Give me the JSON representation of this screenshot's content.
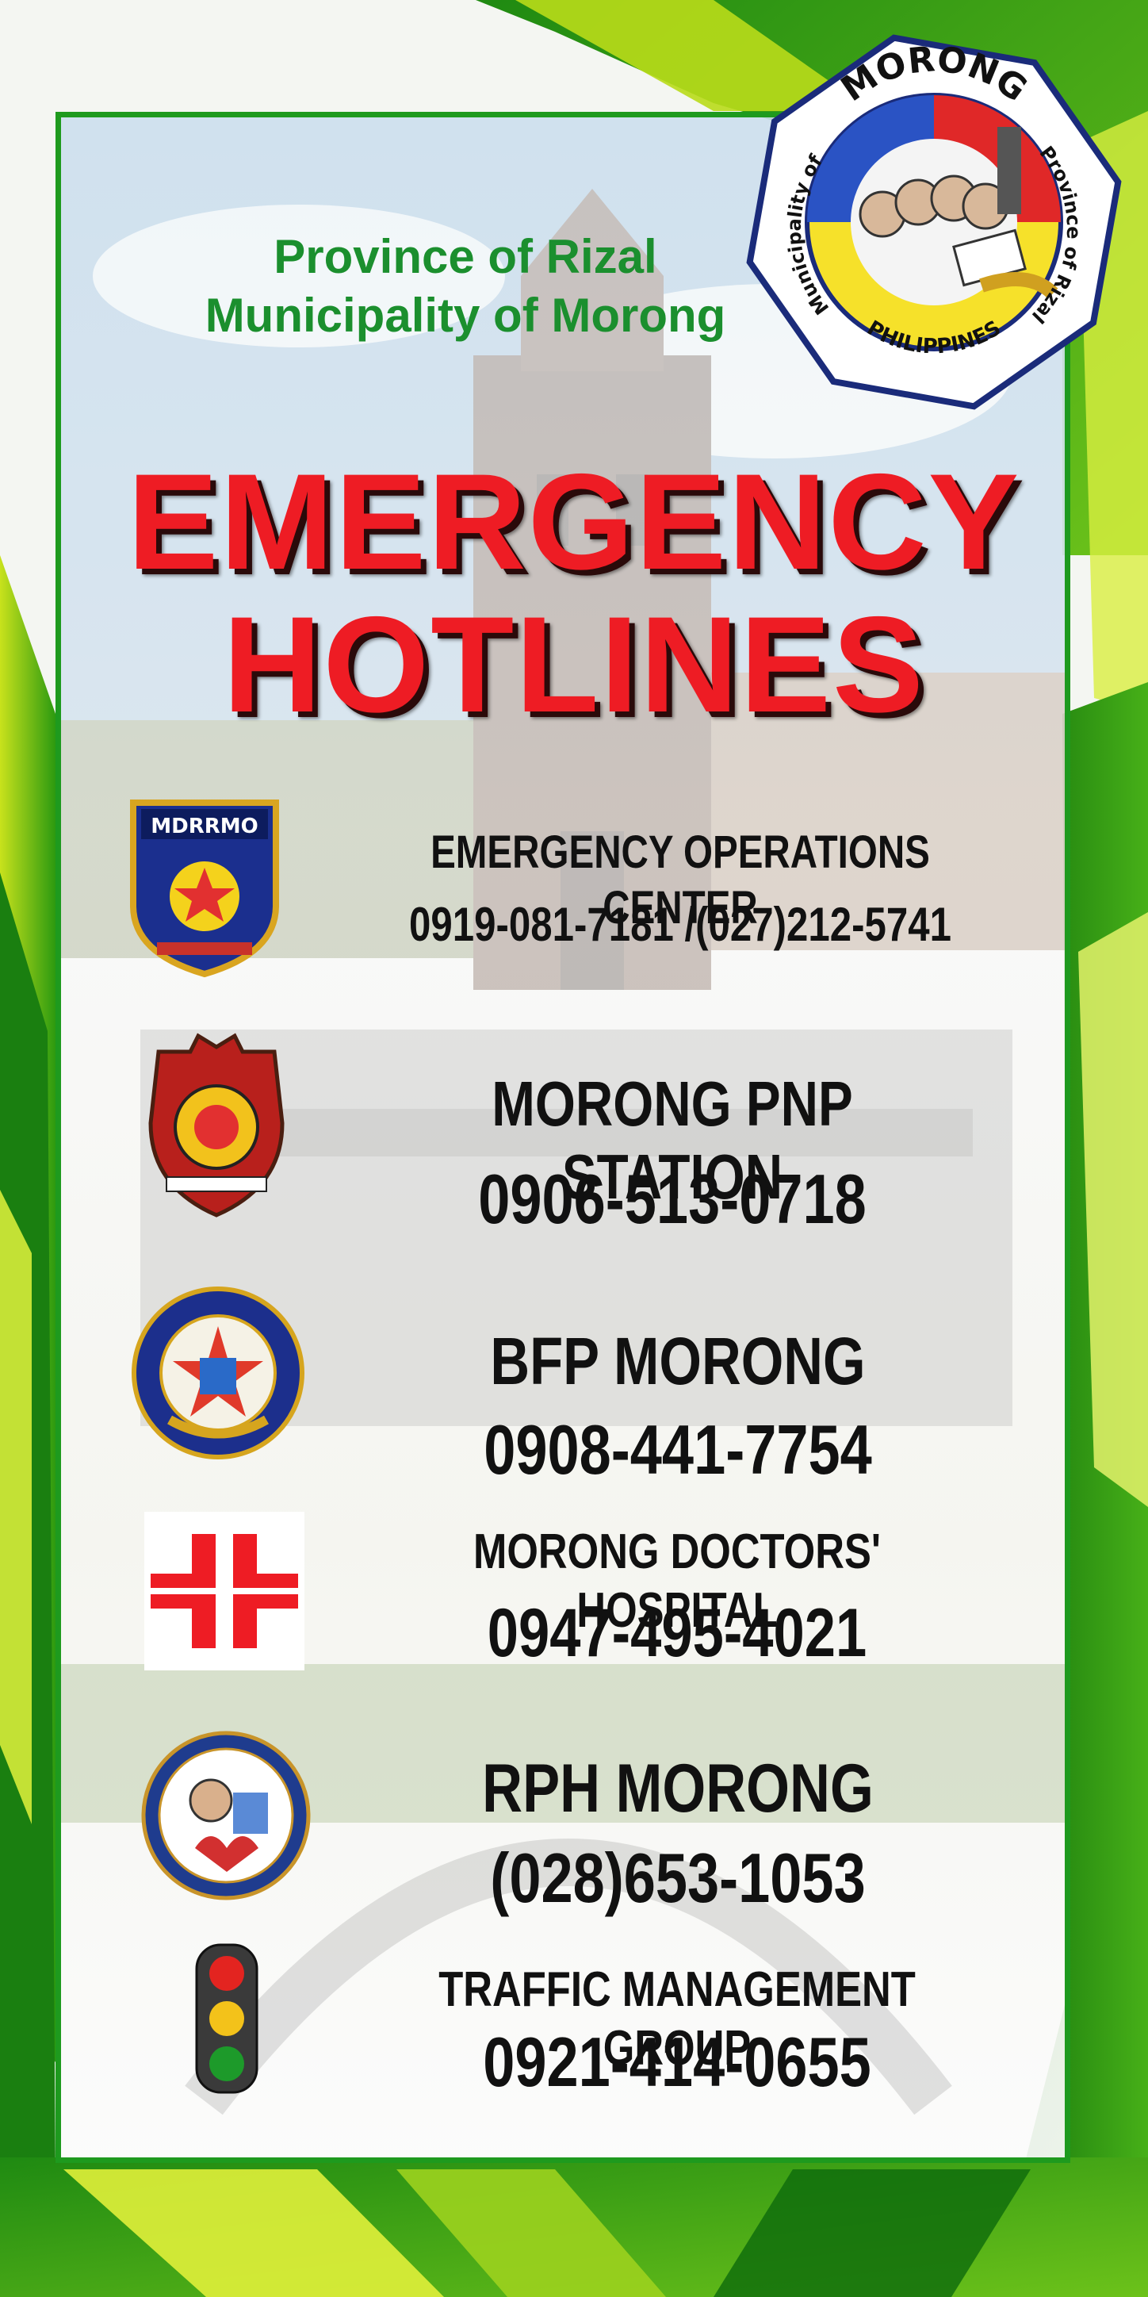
{
  "header": {
    "line1": "Province of Rizal",
    "line2": "Municipality of Morong"
  },
  "seal": {
    "top_text": "MORONG",
    "right_text": "Province of Rizal",
    "left_text": "Municipality of",
    "bottom_text": "PHILIPPINES"
  },
  "title": {
    "line1": "EMERGENCY",
    "line2": "HOTLINES"
  },
  "entries": [
    {
      "name": "EMERGENCY OPERATIONS CENTER",
      "number": "0919-081-7181 /(027)212-5741",
      "logo": "mdrrmo-shield-icon",
      "logo_text": "MDRRMO"
    },
    {
      "name": "MORONG PNP STATION",
      "number": "0906-513-0718",
      "logo": "pnp-badge-icon"
    },
    {
      "name": "BFP MORONG",
      "number": "0908-441-7754",
      "logo": "bfp-seal-icon"
    },
    {
      "name": "MORONG DOCTORS' HOSPITAL",
      "number": "0947-495-4021",
      "logo": "medical-cross-icon"
    },
    {
      "name": "RPH MORONG",
      "number": "(028)653-1053",
      "logo": "rph-seal-icon"
    },
    {
      "name": "TRAFFIC MANAGEMENT GROUP",
      "number": "0921-414-0655",
      "logo": "traffic-light-icon"
    }
  ],
  "colors": {
    "accent_green": "#1e9a1e",
    "title_red": "#ee1c24",
    "header_green": "#1b8f2e",
    "text_black": "#111111"
  }
}
